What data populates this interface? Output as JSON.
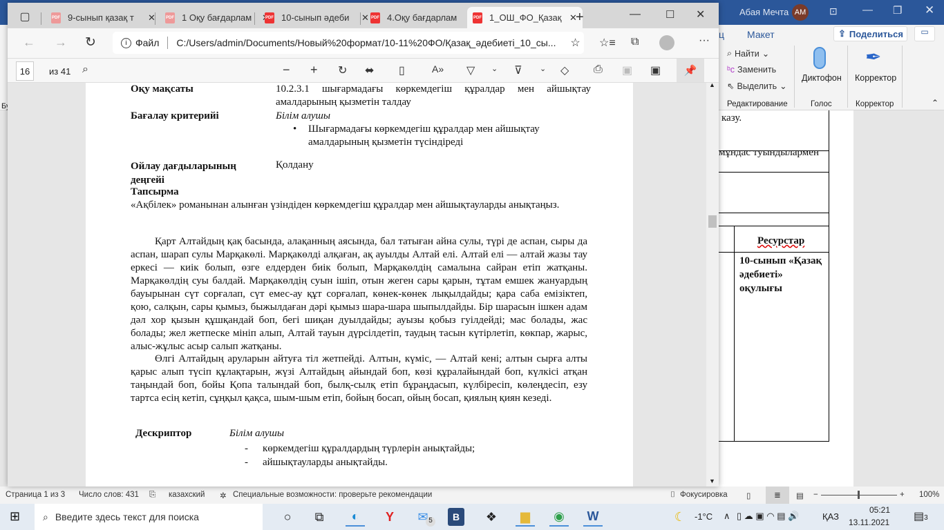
{
  "word": {
    "user": "Абая Мечта",
    "avatar": "АМ",
    "tab_partial": "ц",
    "tab_layout": "Макет",
    "share": "Поделиться",
    "left_partial": "Бу",
    "editing": {
      "find": "Найти",
      "replace": "Заменить",
      "select": "Выделить",
      "group": "Редактирование"
    },
    "voice": {
      "dictate": "Диктофон",
      "group": "Голос"
    },
    "editor": {
      "label": "Корректор",
      "group": "Корректор"
    },
    "doc": {
      "row1": "казу.",
      "row2": "мұндас туындылармен",
      "resources_header": "Ресурстар",
      "resources_value": "10-сынып «Қазақ әдебиеті» оқулығы"
    },
    "status": {
      "page": "Страница 1 из 3",
      "words": "Число слов: 431",
      "language": "казахский",
      "accessibility": "Специальные возможности: проверьте рекомендации",
      "focus": "Фокусировка",
      "zoom": "100%"
    }
  },
  "edge": {
    "tabs": [
      {
        "title": "9-сынып қазақ т"
      },
      {
        "title": "1 Оқу бағдарлам"
      },
      {
        "title": "10-сынып әдеби"
      },
      {
        "title": "4.Оқу бағдарлам"
      },
      {
        "title": "1_ОШ_ФО_Қазақ"
      }
    ],
    "file_label": "Файл",
    "url": "C:/Users/admin/Documents/Новый%20формат/10-11%20ФО/Қазақ_әдебиеті_10_сы...",
    "pdf": {
      "page": "16",
      "of": "из 41"
    }
  },
  "document": {
    "goal_label": "Оқу мақсаты",
    "goal_text": "10.2.3.1 шығармадағы көркемдегіш құралдар мен айшықтау амалдарының қызметін талдау",
    "criteria_label": "Бағалау критерийі",
    "criteria_lead": "Білім алушы",
    "criteria_bullet": "Шығармадағы көркемдегіш құралдар мен айшықтау амалдарының қызметін түсіндіреді",
    "thinking_label": "Ойлау дағдыларының деңгейі",
    "thinking_value": "Қолдану",
    "task_label": "Тапсырма",
    "task_text": "«Ақбілек» романынан алынған үзіндіден көркемдегіш құралдар мен айшықтауларды анықтаңыз.",
    "para1": "Қарт Алтайдың қақ басында, алақанның аясында, бал татыған айна сулы, түрі де аспан, сыры да аспан, шарап сулы Марқакөлі. Марқакөлді алқаған, ақ ауылды Алтай елі. Алтай елі — алтай жазы тау еркесі — киік болып, өзге елдерден биік болып, Марқакөлдің самалына сайран етіп жатқаны. Марқакөлдің суы балдай. Марқакөлдің суын ішіп, отын жеген сары қарын, тұтам емшек жануардың бауырынан сүт сорғалап, сүт емес-ау құт сорғалап, көнек-көнек лықылдайды; қара саба емізіктеп, қою, салқын, сары қымыз, быжылдаған дәрі қымыз шара-шара шыпылдайды. Бір шарасын ішкен адам дәл хор қызын құшқандай боп, бегі шиқан дуылдайды; ауызы қобыз гуілдейді; мас болады, жас болады; жел жетпеске мініп алып, Алтай тауын дүрсілдетіп, таудың тасын күтірлетіп, көкпар, жарыс, алыс-жұлыс асыр салып жатқаны.",
    "para2": "Өлгі Алтайдың аруларын айтуға тіл жетпейді. Алтын, күміс, — Алтай кені; алтын сырға алты қарыс алып түсіп құлақтарын, жүзі Алтайдың айындай боп, көзі құралайындай боп, күлкісі атқан таңындай боп, бойы Қопа талындай боп, былқ-сылқ етіп бұраңдасып, күлбіресіп, көлеңдесіп, езу тартса есің кетіп, сұңқыл қақса, шым-шым етіп, бойың босап, ойың босап, қиялың қиян кезеді.",
    "descriptor_label": "Дескриптор",
    "descriptor_lead": "Білім алушы",
    "descriptor_items": [
      "көркемдегіш құралдардың түрлерін анықтайды;",
      "айшықтауларды анықтайды."
    ]
  },
  "taskbar": {
    "search_placeholder": "Введите здесь текст для поиска",
    "mail_badge": "5",
    "weather": "-1°C",
    "lang": "ҚАЗ",
    "time": "05:21",
    "date": "13.11.2021",
    "notif": "3"
  }
}
